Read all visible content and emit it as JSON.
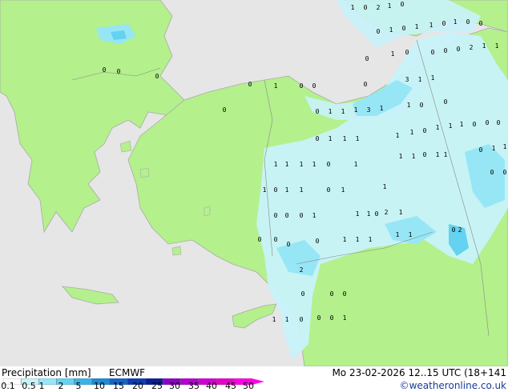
{
  "legend": {
    "title": "Precipitation [mm]",
    "model": "ECMWF",
    "datetime": "Mo 23-02-2026 12..15 UTC (18+141",
    "credit": "©weatheronline.co.uk",
    "ticks": [
      "0.1",
      "0.5",
      "1",
      "2",
      "5",
      "10",
      "15",
      "20",
      "25",
      "30",
      "35",
      "40",
      "45",
      "50"
    ],
    "colors": [
      "#ffffff",
      "#c8f2fa",
      "#96e6f6",
      "#64d2f0",
      "#3cb4e6",
      "#1e8cd2",
      "#1464c8",
      "#0a3cb4",
      "#0a1e96",
      "#8c00c8",
      "#b400d2",
      "#d200d2",
      "#e600c8",
      "#ff00e6"
    ]
  },
  "map": {
    "colors": {
      "sea": "#e6e6e6",
      "land": "#b4f08c",
      "precip_light": "#c8f2fa",
      "precip_mid": "#96e6f6",
      "precip_heavy": "#64d2f0",
      "coast": "#aaaaaa"
    },
    "values": [
      {
        "t": "1"
      },
      {
        "t": "0"
      },
      {
        "t": "2"
      },
      {
        "t": "1"
      },
      {
        "t": "0"
      },
      {
        "t": "0"
      },
      {
        "t": "1"
      },
      {
        "t": "0"
      },
      {
        "t": "1"
      },
      {
        "t": "1"
      },
      {
        "t": "0"
      },
      {
        "t": "1"
      },
      {
        "t": "0"
      },
      {
        "t": "0"
      },
      {
        "t": "0"
      },
      {
        "t": "0"
      },
      {
        "t": "0"
      },
      {
        "t": "0"
      },
      {
        "t": "1"
      },
      {
        "t": "0"
      },
      {
        "t": "0"
      },
      {
        "t": "0"
      },
      {
        "t": "0"
      },
      {
        "t": "2"
      },
      {
        "t": "1"
      },
      {
        "t": "1"
      },
      {
        "t": "0"
      },
      {
        "t": "1"
      },
      {
        "t": "0"
      },
      {
        "t": "0"
      },
      {
        "t": "0"
      },
      {
        "t": "3"
      },
      {
        "t": "1"
      },
      {
        "t": "1"
      },
      {
        "t": "0"
      },
      {
        "t": "0"
      },
      {
        "t": "1"
      },
      {
        "t": "1"
      },
      {
        "t": "1"
      },
      {
        "t": "3"
      },
      {
        "t": "1"
      },
      {
        "t": "1"
      },
      {
        "t": "0"
      },
      {
        "t": "0"
      },
      {
        "t": "1"
      },
      {
        "t": "1"
      },
      {
        "t": "0"
      },
      {
        "t": "1"
      },
      {
        "t": "1"
      },
      {
        "t": "1"
      },
      {
        "t": "0"
      },
      {
        "t": "0"
      },
      {
        "t": "0"
      },
      {
        "t": "1"
      },
      {
        "t": "1"
      },
      {
        "t": "0"
      },
      {
        "t": "1"
      },
      {
        "t": "1"
      },
      {
        "t": "0"
      },
      {
        "t": "1"
      },
      {
        "t": "1"
      },
      {
        "t": "0"
      },
      {
        "t": "1"
      },
      {
        "t": "1"
      },
      {
        "t": "1"
      },
      {
        "t": "0"
      },
      {
        "t": "0"
      },
      {
        "t": "1"
      },
      {
        "t": "1"
      },
      {
        "t": "1"
      },
      {
        "t": "1"
      },
      {
        "t": "0"
      },
      {
        "t": "1"
      },
      {
        "t": "1"
      },
      {
        "t": "1"
      },
      {
        "t": "0"
      },
      {
        "t": "1"
      },
      {
        "t": "1"
      },
      {
        "t": "0"
      },
      {
        "t": "1"
      },
      {
        "t": "2"
      },
      {
        "t": "0"
      },
      {
        "t": "1"
      },
      {
        "t": "0"
      },
      {
        "t": "0"
      },
      {
        "t": "0"
      },
      {
        "t": "1"
      },
      {
        "t": "1"
      },
      {
        "t": "1"
      },
      {
        "t": "1"
      },
      {
        "t": "1"
      },
      {
        "t": "2"
      },
      {
        "t": "1"
      },
      {
        "t": "1"
      },
      {
        "t": "1"
      },
      {
        "t": "0"
      },
      {
        "t": "0"
      },
      {
        "t": "0"
      },
      {
        "t": "0"
      },
      {
        "t": "0"
      },
      {
        "t": "2"
      },
      {
        "t": "0"
      },
      {
        "t": "0"
      },
      {
        "t": "0"
      },
      {
        "t": "0"
      },
      {
        "t": "0"
      },
      {
        "t": "1"
      },
      {
        "t": "0"
      },
      {
        "t": "1"
      },
      {
        "t": "1"
      }
    ]
  }
}
